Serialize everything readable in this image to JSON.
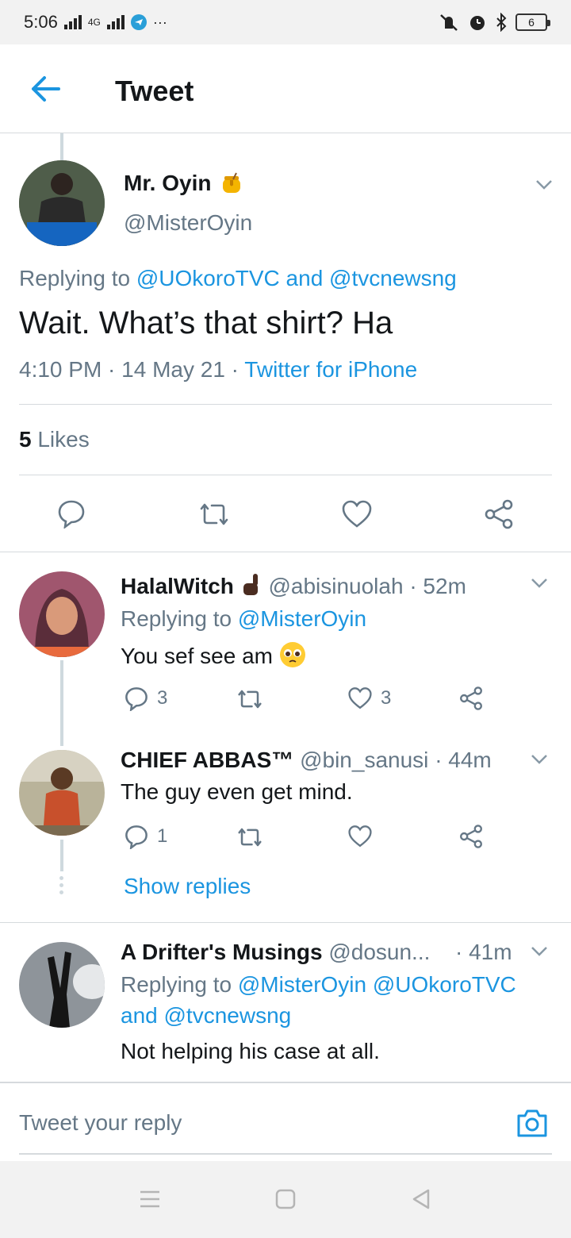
{
  "status": {
    "time": "5:06",
    "network": "4G",
    "battery": "6"
  },
  "header": {
    "title": "Tweet"
  },
  "main_tweet": {
    "name": "Mr. Oyin",
    "handle": "@MisterOyin",
    "replying_prefix": "Replying to",
    "replying_to": "@UOkoroTVC and @tvcnewsng",
    "text": "Wait. What’s that shirt? Ha",
    "time": "4:10 PM · 14 May 21 ·",
    "source": "Twitter for iPhone",
    "likes_count": "5",
    "likes_label": "Likes"
  },
  "replies": [
    {
      "name": "HalalWitch",
      "handle": "@abisinuolah",
      "age": "· 52m",
      "replying_prefix": "Replying to",
      "replying_to": "@MisterOyin",
      "text": "You sef see am",
      "reply_count": "3",
      "like_count": "3"
    },
    {
      "name": "CHIEF ABBAS™",
      "handle": "@bin_sanusi",
      "age": "· 44m",
      "text": "The guy even get mind.",
      "reply_count": "1",
      "show_replies": "Show replies"
    },
    {
      "name": "A Drifter's Musings",
      "handle": "@dosun...",
      "age": "· 41m",
      "replying_prefix": "Replying to",
      "replying_line1": "@MisterOyin @UOkoroTVC",
      "replying_line2": "and @tvcnewsng",
      "text": "Not helping his case at all."
    }
  ],
  "composer": {
    "placeholder": "Tweet your reply"
  },
  "colors": {
    "accent": "#1b95e0",
    "muted": "#657786",
    "divider": "#d6dadd"
  }
}
